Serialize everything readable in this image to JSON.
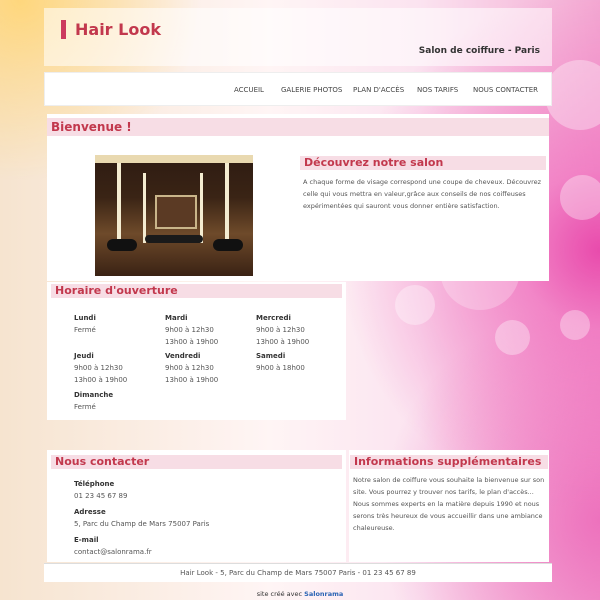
{
  "header": {
    "title": "Hair Look",
    "subtitle": "Salon de coiffure - Paris"
  },
  "nav": {
    "items": [
      "ACCUEIL",
      "GALERIE PHOTOS",
      "PLAN D'ACCÈS",
      "NOS TARIFS",
      "NOUS CONTACTER"
    ]
  },
  "welcome": {
    "title": "Bienvenue !",
    "section_title": "Découvrez notre salon",
    "body": "A chaque forme de visage correspond une coupe de cheveux. Découvrez celle qui vous mettra en valeur,grâce aux conseils de nos coiffeuses expérimentées qui sauront vous donner entière satisfaction."
  },
  "hours": {
    "title": "Horaire d'ouverture",
    "days": [
      {
        "day": "Lundi",
        "lines": [
          "Fermé"
        ]
      },
      {
        "day": "Mardi",
        "lines": [
          "9h00 à 12h30",
          "13h00 à 19h00"
        ]
      },
      {
        "day": "Mercredi",
        "lines": [
          "9h00 à 12h30",
          "13h00 à 19h00"
        ]
      },
      {
        "day": "Jeudi",
        "lines": [
          "9h00 à 12h30",
          "13h00 à 19h00"
        ]
      },
      {
        "day": "Vendredi",
        "lines": [
          "9h00 à 12h30",
          "13h00 à 19h00"
        ]
      },
      {
        "day": "Samedi",
        "lines": [
          "9h00 à 18h00"
        ]
      },
      {
        "day": "Dimanche",
        "lines": [
          "Fermé"
        ]
      }
    ]
  },
  "contact": {
    "title": "Nous contacter",
    "phone_label": "Téléphone",
    "phone": "01 23 45 67 89",
    "address_label": "Adresse",
    "address": "5, Parc du Champ de Mars 75007 Paris",
    "email_label": "E-mail",
    "email": "contact@salonrama.fr"
  },
  "info": {
    "title": "Informations supplémentaires",
    "body": "Notre salon de coiffure vous souhaite la bienvenue sur son site. Vous pourrez y trouver nos tarifs, le plan d'accès... Nous sommes experts en la matière depuis 1990 et nous serons très heureux de vous accueillir dans une ambiance chaleureuse."
  },
  "footer": {
    "text": "Hair Look - 5, Parc du Champ de Mars 75007 Paris - 01 23 45 67 89"
  },
  "credit": {
    "prefix": "site créé avec ",
    "link": "Salonrama"
  }
}
